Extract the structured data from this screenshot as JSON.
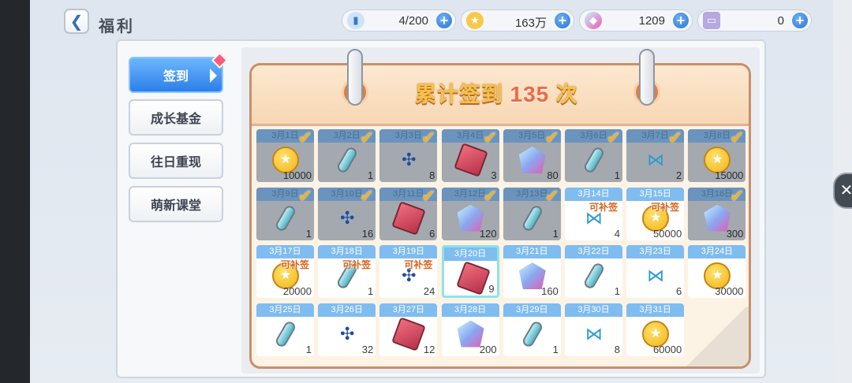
{
  "header": {
    "back_icon": "chevron-left-icon",
    "title": "福利",
    "resources": [
      {
        "name": "stamina",
        "icon": "stamina-bottle-icon",
        "value": "4/200"
      },
      {
        "name": "coins",
        "icon": "star-coin-icon",
        "value": "163万"
      },
      {
        "name": "crystals",
        "icon": "crystal-icon",
        "value": "1209"
      },
      {
        "name": "tickets",
        "icon": "ticket-icon",
        "value": "0"
      }
    ]
  },
  "sidebar": {
    "items": [
      {
        "label": "签到",
        "active": true
      },
      {
        "label": "成长基金",
        "active": false
      },
      {
        "label": "往日重现",
        "active": false
      },
      {
        "label": "萌新课堂",
        "active": false
      }
    ]
  },
  "calendar": {
    "title_prefix": "累计签到",
    "count": "135",
    "title_suffix": "次",
    "makeup_label": "可补签",
    "days": [
      {
        "date": "3月1日",
        "item": "coin",
        "count": "10000",
        "status": "claimed"
      },
      {
        "date": "3月2日",
        "item": "scroll",
        "count": "1",
        "status": "claimed"
      },
      {
        "date": "3月3日",
        "item": "drone",
        "count": "8",
        "status": "claimed"
      },
      {
        "date": "3月4日",
        "item": "cloth",
        "count": "3",
        "status": "claimed"
      },
      {
        "date": "3月5日",
        "item": "crystal",
        "count": "80",
        "status": "claimed"
      },
      {
        "date": "3月6日",
        "item": "scroll",
        "count": "1",
        "status": "claimed"
      },
      {
        "date": "3月7日",
        "item": "candy",
        "count": "2",
        "status": "claimed"
      },
      {
        "date": "3月8日",
        "item": "coin",
        "count": "15000",
        "status": "claimed"
      },
      {
        "date": "3月9日",
        "item": "scroll",
        "count": "1",
        "status": "claimed"
      },
      {
        "date": "3月10日",
        "item": "drone",
        "count": "16",
        "status": "claimed"
      },
      {
        "date": "3月11日",
        "item": "cloth",
        "count": "6",
        "status": "claimed"
      },
      {
        "date": "3月12日",
        "item": "crystal",
        "count": "120",
        "status": "claimed"
      },
      {
        "date": "3月13日",
        "item": "scroll",
        "count": "1",
        "status": "claimed"
      },
      {
        "date": "3月14日",
        "item": "candy",
        "count": "4",
        "status": "makeup"
      },
      {
        "date": "3月15日",
        "item": "coin",
        "count": "50000",
        "status": "makeup"
      },
      {
        "date": "3月16日",
        "item": "crystal",
        "count": "300",
        "status": "claimed"
      },
      {
        "date": "3月17日",
        "item": "coin",
        "count": "20000",
        "status": "makeup"
      },
      {
        "date": "3月18日",
        "item": "scroll",
        "count": "1",
        "status": "makeup"
      },
      {
        "date": "3月19日",
        "item": "drone",
        "count": "24",
        "status": "makeup"
      },
      {
        "date": "3月20日",
        "item": "cloth",
        "count": "9",
        "status": "today"
      },
      {
        "date": "3月21日",
        "item": "crystal",
        "count": "160",
        "status": "future"
      },
      {
        "date": "3月22日",
        "item": "scroll",
        "count": "1",
        "status": "future"
      },
      {
        "date": "3月23日",
        "item": "candy",
        "count": "6",
        "status": "future"
      },
      {
        "date": "3月24日",
        "item": "coin",
        "count": "30000",
        "status": "future"
      },
      {
        "date": "3月25日",
        "item": "scroll",
        "count": "1",
        "status": "future"
      },
      {
        "date": "3月26日",
        "item": "drone",
        "count": "32",
        "status": "future"
      },
      {
        "date": "3月27日",
        "item": "cloth",
        "count": "12",
        "status": "future"
      },
      {
        "date": "3月28日",
        "item": "crystal",
        "count": "200",
        "status": "future"
      },
      {
        "date": "3月29日",
        "item": "scroll",
        "count": "1",
        "status": "future"
      },
      {
        "date": "3月30日",
        "item": "candy",
        "count": "8",
        "status": "future"
      },
      {
        "date": "3月31日",
        "item": "coin",
        "count": "60000",
        "status": "future"
      }
    ]
  },
  "side_button_icon": "close-icon"
}
